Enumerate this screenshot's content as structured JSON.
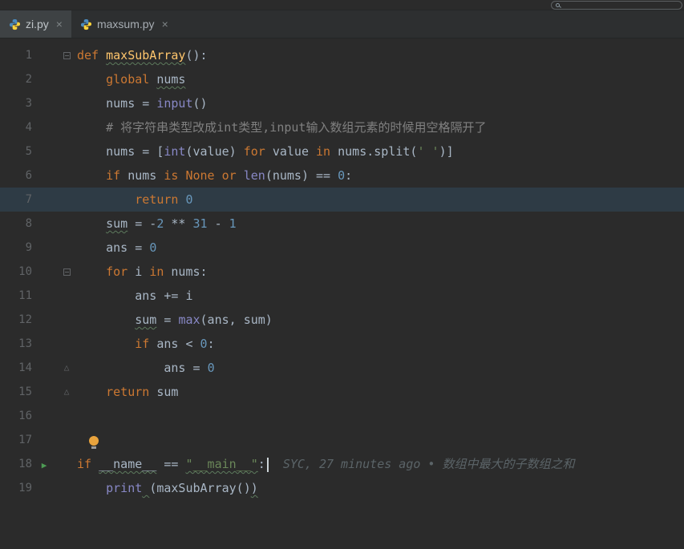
{
  "topbar": {
    "search_value": ""
  },
  "tabs": [
    {
      "label": "zi.py",
      "close": "×",
      "active": true
    },
    {
      "label": "maxsum.py",
      "close": "×",
      "active": false
    }
  ],
  "icons": {
    "run_icon": "▶",
    "fold_end_icon": "△",
    "python_icon": "python-logo"
  },
  "colors": {
    "background": "#2b2b2b",
    "keyword": "#cc7832",
    "number": "#6897bb",
    "string": "#6a8759",
    "comment": "#808080",
    "builtin": "#8888c6",
    "function": "#ffc66d",
    "plain": "#a9b7c6",
    "line_highlight": "#2e3b45",
    "run_green": "#4d9b54"
  },
  "editor": {
    "lines": [
      {
        "n": 1,
        "fold": "start",
        "tokens": [
          {
            "t": "def ",
            "c": "kw"
          },
          {
            "t": "maxSubArray",
            "c": "fn",
            "u": true
          },
          {
            "t": "():",
            "c": "plain"
          }
        ]
      },
      {
        "n": 2,
        "tokens": [
          {
            "t": "    ",
            "c": "plain"
          },
          {
            "t": "global ",
            "c": "kw"
          },
          {
            "t": "nums",
            "c": "plain",
            "u": true
          }
        ]
      },
      {
        "n": 3,
        "tokens": [
          {
            "t": "    nums = ",
            "c": "plain"
          },
          {
            "t": "input",
            "c": "builtin"
          },
          {
            "t": "()",
            "c": "plain"
          }
        ]
      },
      {
        "n": 4,
        "tokens": [
          {
            "t": "    ",
            "c": "plain"
          },
          {
            "t": "# 将字符串类型改成int类型,input输入数组元素的时候用空格隔开了",
            "c": "com"
          }
        ]
      },
      {
        "n": 5,
        "tokens": [
          {
            "t": "    nums = [",
            "c": "plain"
          },
          {
            "t": "int",
            "c": "builtin"
          },
          {
            "t": "(value) ",
            "c": "plain"
          },
          {
            "t": "for",
            "c": "kw"
          },
          {
            "t": " value ",
            "c": "plain"
          },
          {
            "t": "in",
            "c": "kw"
          },
          {
            "t": " nums.split(",
            "c": "plain"
          },
          {
            "t": "' '",
            "c": "str"
          },
          {
            "t": ")]",
            "c": "plain"
          }
        ]
      },
      {
        "n": 6,
        "tokens": [
          {
            "t": "    ",
            "c": "plain"
          },
          {
            "t": "if",
            "c": "kw"
          },
          {
            "t": " nums ",
            "c": "plain"
          },
          {
            "t": "is",
            "c": "kw"
          },
          {
            "t": " ",
            "c": "plain"
          },
          {
            "t": "None",
            "c": "kw"
          },
          {
            "t": " ",
            "c": "plain"
          },
          {
            "t": "or",
            "c": "kw"
          },
          {
            "t": " ",
            "c": "plain"
          },
          {
            "t": "len",
            "c": "builtin"
          },
          {
            "t": "(nums) == ",
            "c": "plain"
          },
          {
            "t": "0",
            "c": "num"
          },
          {
            "t": ":",
            "c": "plain"
          }
        ]
      },
      {
        "n": 7,
        "highlight": true,
        "tokens": [
          {
            "t": "        ",
            "c": "plain"
          },
          {
            "t": "return",
            "c": "kw"
          },
          {
            "t": " ",
            "c": "plain"
          },
          {
            "t": "0",
            "c": "num"
          }
        ]
      },
      {
        "n": 8,
        "tokens": [
          {
            "t": "    ",
            "c": "plain"
          },
          {
            "t": "sum",
            "c": "plain",
            "u": true
          },
          {
            "t": " = -",
            "c": "plain"
          },
          {
            "t": "2",
            "c": "num"
          },
          {
            "t": " ** ",
            "c": "plain"
          },
          {
            "t": "31",
            "c": "num"
          },
          {
            "t": " - ",
            "c": "plain"
          },
          {
            "t": "1",
            "c": "num"
          }
        ]
      },
      {
        "n": 9,
        "tokens": [
          {
            "t": "    ans = ",
            "c": "plain"
          },
          {
            "t": "0",
            "c": "num"
          }
        ]
      },
      {
        "n": 10,
        "fold": "start",
        "tokens": [
          {
            "t": "    ",
            "c": "plain"
          },
          {
            "t": "for",
            "c": "kw"
          },
          {
            "t": " i ",
            "c": "plain"
          },
          {
            "t": "in",
            "c": "kw"
          },
          {
            "t": " nums:",
            "c": "plain"
          }
        ]
      },
      {
        "n": 11,
        "tokens": [
          {
            "t": "        ans += i",
            "c": "plain"
          }
        ]
      },
      {
        "n": 12,
        "tokens": [
          {
            "t": "        ",
            "c": "plain"
          },
          {
            "t": "sum",
            "c": "plain",
            "u": true
          },
          {
            "t": " = ",
            "c": "plain"
          },
          {
            "t": "max",
            "c": "builtin"
          },
          {
            "t": "(ans, sum)",
            "c": "plain"
          }
        ]
      },
      {
        "n": 13,
        "tokens": [
          {
            "t": "        ",
            "c": "plain"
          },
          {
            "t": "if",
            "c": "kw"
          },
          {
            "t": " ans < ",
            "c": "plain"
          },
          {
            "t": "0",
            "c": "num"
          },
          {
            "t": ":",
            "c": "plain"
          }
        ]
      },
      {
        "n": 14,
        "fold": "end",
        "tokens": [
          {
            "t": "            ans = ",
            "c": "plain"
          },
          {
            "t": "0",
            "c": "num"
          }
        ]
      },
      {
        "n": 15,
        "fold": "end",
        "tokens": [
          {
            "t": "    ",
            "c": "plain"
          },
          {
            "t": "return",
            "c": "kw"
          },
          {
            "t": " sum",
            "c": "plain"
          }
        ]
      },
      {
        "n": 16,
        "tokens": []
      },
      {
        "n": 17,
        "tokens": [
          {
            "t": " ",
            "c": "plain"
          },
          {
            "t": "",
            "c": "bulb"
          }
        ]
      },
      {
        "n": 18,
        "run": true,
        "tokens": [
          {
            "t": "if ",
            "c": "kw"
          },
          {
            "t": "__name__",
            "c": "plain",
            "u": true
          },
          {
            "t": " == ",
            "c": "plain"
          },
          {
            "t": "\"__main__\"",
            "c": "str",
            "u": true
          },
          {
            "t": ":",
            "c": "plain"
          },
          {
            "t": "",
            "c": "caret"
          },
          {
            "t": "SYC, 27 minutes ago • 数组中最大的子数组之和",
            "c": "blame"
          }
        ]
      },
      {
        "n": 19,
        "tokens": [
          {
            "t": "    ",
            "c": "plain"
          },
          {
            "t": "print",
            "c": "builtin"
          },
          {
            "t": " ",
            "c": "plain",
            "u": true
          },
          {
            "t": "(maxSubArray()",
            "c": "plain"
          },
          {
            "t": ")",
            "c": "plain",
            "u": true
          }
        ]
      }
    ]
  }
}
